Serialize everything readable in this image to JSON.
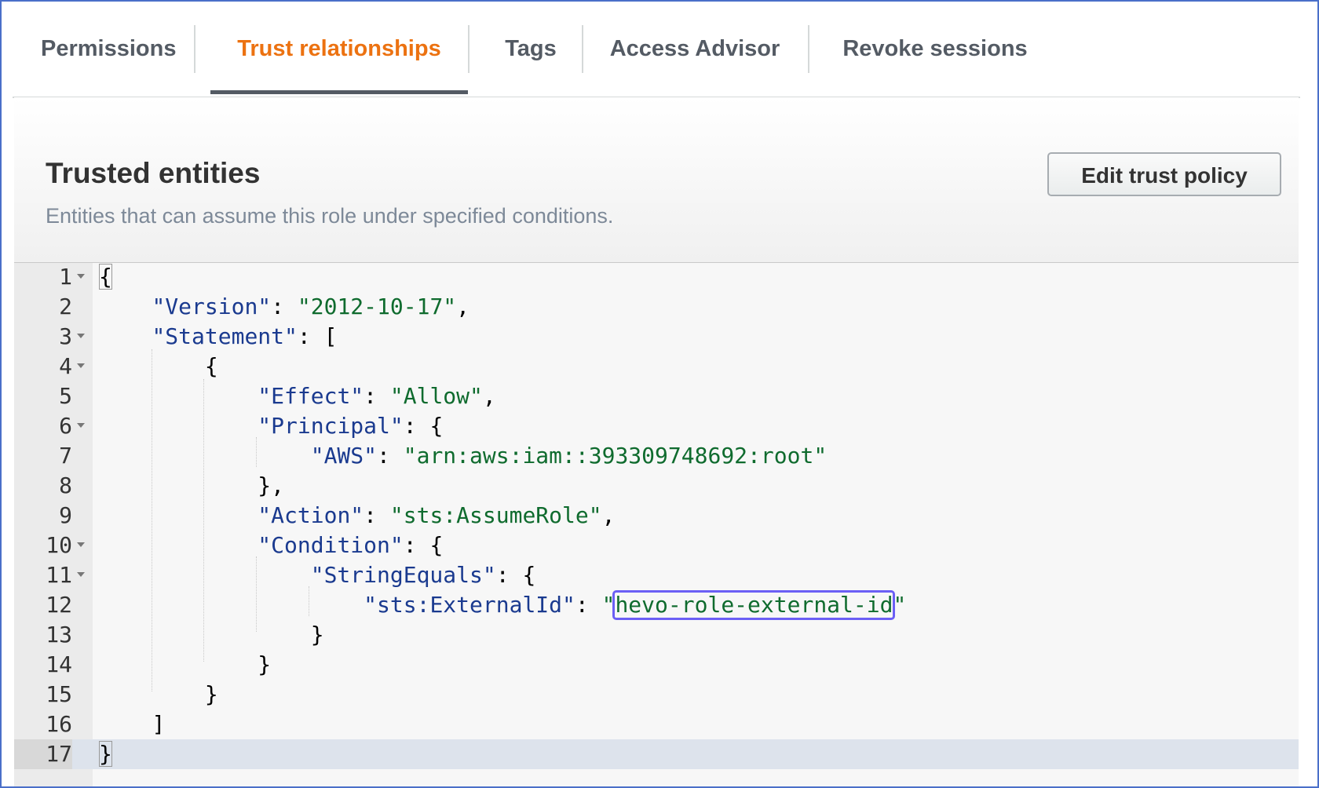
{
  "tabs": [
    {
      "label": "Permissions"
    },
    {
      "label": "Trust relationships"
    },
    {
      "label": "Tags"
    },
    {
      "label": "Access Advisor"
    },
    {
      "label": "Revoke sessions"
    }
  ],
  "active_tab": "Trust relationships",
  "colors": {
    "active_tab": "#ec7211",
    "highlight": "#6b5ff5"
  },
  "panel": {
    "title": "Trusted entities",
    "description": "Entities that can assume this role under specified conditions.",
    "edit_button": "Edit trust policy"
  },
  "editor": {
    "line_numbers": [
      "1",
      "2",
      "3",
      "4",
      "5",
      "6",
      "7",
      "8",
      "9",
      "10",
      "11",
      "12",
      "13",
      "14",
      "15",
      "16",
      "17"
    ],
    "policy": {
      "version_key": "\"Version\"",
      "version_value": "\"2012-10-17\"",
      "statement_key": "\"Statement\"",
      "effect_key": "\"Effect\"",
      "effect_value": "\"Allow\"",
      "principal_key": "\"Principal\"",
      "aws_key": "\"AWS\"",
      "aws_value": "\"arn:aws:iam::393309748692:root\"",
      "action_key": "\"Action\"",
      "action_value": "\"sts:AssumeRole\"",
      "condition_key": "\"Condition\"",
      "string_equals_key": "\"StringEquals\"",
      "external_id_key": "\"sts:ExternalId\"",
      "external_id_value": "hevo-role-external-id"
    }
  }
}
